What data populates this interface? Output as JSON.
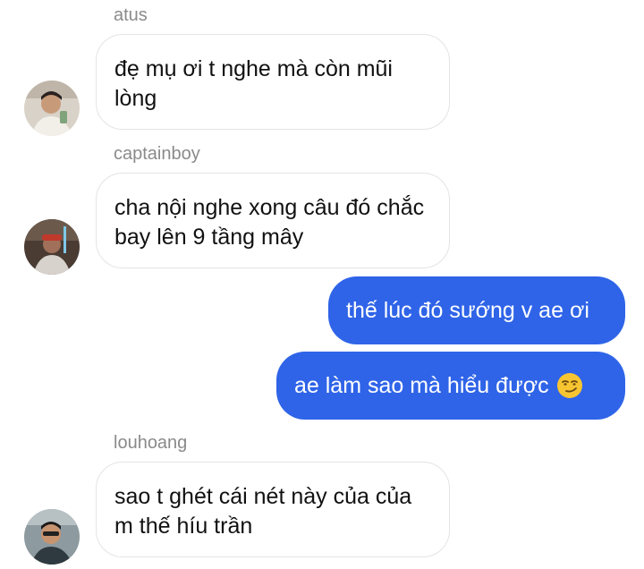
{
  "messages": [
    {
      "sender": "atus",
      "text": "đẹ mụ ơi t nghe mà còn mũi lòng",
      "avatar_icon": "user-avatar-atus"
    },
    {
      "sender": "captainboy",
      "text": "cha nội nghe xong câu đó chắc bay lên 9 tầng mây",
      "avatar_icon": "user-avatar-captainboy"
    },
    {
      "sender": "me",
      "text": "thế lúc đó sướng v ae ơi"
    },
    {
      "sender": "me",
      "text": "ae làm sao mà hiểu được",
      "emoji": "smirking-face-emoji"
    },
    {
      "sender": "louhoang",
      "text": "sao t ghét cái nét này của của m thế híu trần",
      "avatar_icon": "user-avatar-louhoang"
    }
  ],
  "colors": {
    "outgoing_bubble": "#2f64e8",
    "incoming_border": "#e4e4e4",
    "sender_name": "#8a8a8a"
  }
}
